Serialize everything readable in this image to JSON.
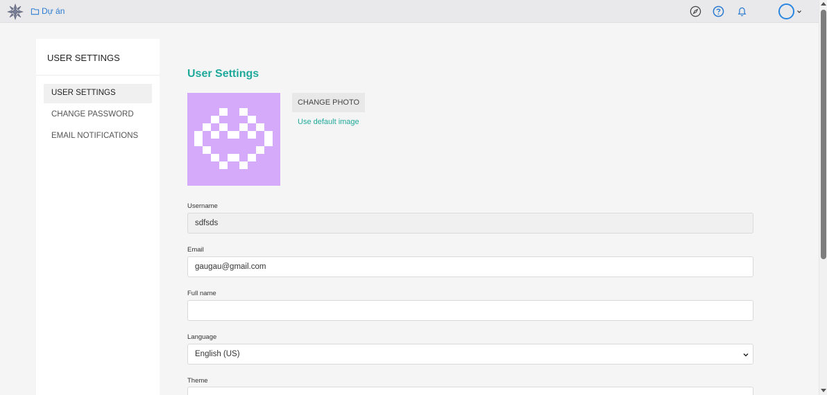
{
  "topbar": {
    "project_label": "Dự án"
  },
  "sidebar": {
    "title": "USER SETTINGS",
    "items": [
      {
        "label": "USER SETTINGS",
        "active": true
      },
      {
        "label": "CHANGE PASSWORD",
        "active": false
      },
      {
        "label": "EMAIL NOTIFICATIONS",
        "active": false
      }
    ]
  },
  "main": {
    "title": "User Settings",
    "change_photo_label": "CHANGE PHOTO",
    "default_image_label": "Use default image",
    "fields": {
      "username": {
        "label": "Username",
        "value": "sdfsds"
      },
      "email": {
        "label": "Email",
        "value": "gaugau@gmail.com"
      },
      "fullname": {
        "label": "Full name",
        "value": ""
      },
      "language": {
        "label": "Language",
        "value": "English (US)"
      },
      "theme": {
        "label": "Theme",
        "value": ""
      }
    }
  },
  "colors": {
    "accent": "#1fa99b",
    "link": "#2a7bd1",
    "avatar_bg": "#d5aafb"
  },
  "icons": [
    "logo-icon",
    "folder-icon",
    "compass-icon",
    "help-icon",
    "bell-icon",
    "chevron-down-icon"
  ]
}
